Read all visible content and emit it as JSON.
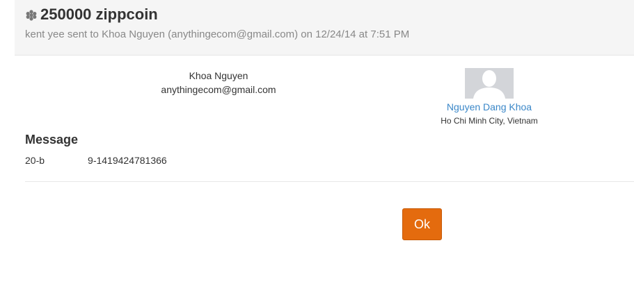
{
  "header": {
    "icon": "coin-cluster-icon",
    "title": "250000 zippcoin",
    "subtitle": "kent yee sent to Khoa Nguyen (anythingecom@gmail.com) on 12/24/14 at 7:51 PM"
  },
  "recipient": {
    "name": "Khoa Nguyen",
    "email": "anythingecom@gmail.com"
  },
  "profile": {
    "avatar": "default-avatar-icon",
    "name": "Nguyen Dang Khoa",
    "location": "Ho Chi Minh City, Vietnam",
    "link_color": "#3a87c8"
  },
  "message": {
    "heading": "Message",
    "text_prefix": "20-b",
    "text_suffix": "9-1419424781366"
  },
  "actions": {
    "ok_label": "Ok",
    "ok_color": "#e46b0e"
  }
}
